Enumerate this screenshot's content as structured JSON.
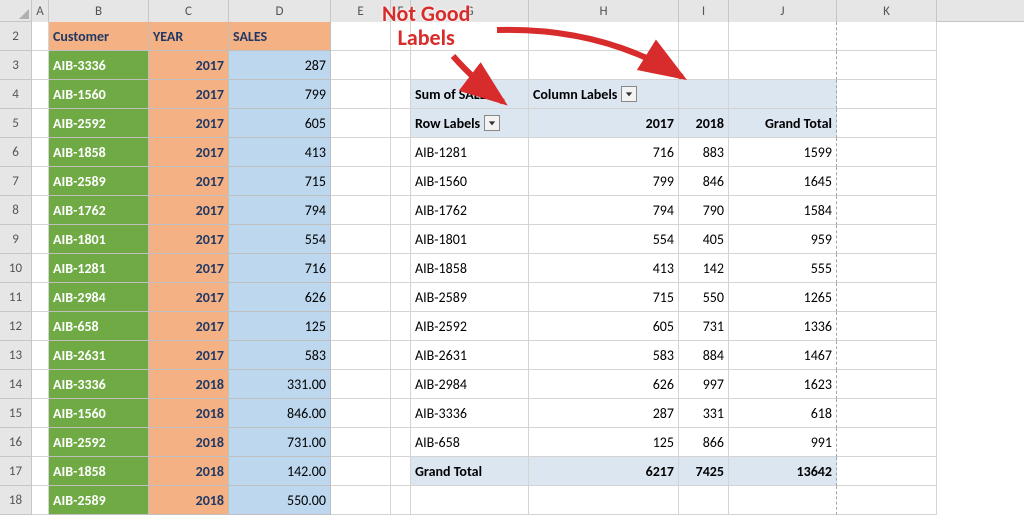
{
  "columns": [
    "A",
    "B",
    "C",
    "D",
    "E",
    "F",
    "G",
    "H",
    "I",
    "J",
    "K"
  ],
  "rowNumbers": [
    2,
    3,
    4,
    5,
    6,
    7,
    8,
    9,
    10,
    11,
    12,
    13,
    14,
    15,
    16,
    17,
    18
  ],
  "source": {
    "headers": {
      "customer": "Customer",
      "year": "YEAR",
      "sales": "SALES"
    },
    "rows": [
      {
        "customer": "AIB-3336",
        "year": "2017",
        "sales": "287"
      },
      {
        "customer": "AIB-1560",
        "year": "2017",
        "sales": "799"
      },
      {
        "customer": "AIB-2592",
        "year": "2017",
        "sales": "605"
      },
      {
        "customer": "AIB-1858",
        "year": "2017",
        "sales": "413"
      },
      {
        "customer": "AIB-2589",
        "year": "2017",
        "sales": "715"
      },
      {
        "customer": "AIB-1762",
        "year": "2017",
        "sales": "794"
      },
      {
        "customer": "AIB-1801",
        "year": "2017",
        "sales": "554"
      },
      {
        "customer": "AIB-1281",
        "year": "2017",
        "sales": "716"
      },
      {
        "customer": "AIB-2984",
        "year": "2017",
        "sales": "626"
      },
      {
        "customer": "AIB-658",
        "year": "2017",
        "sales": "125"
      },
      {
        "customer": "AIB-2631",
        "year": "2017",
        "sales": "583"
      },
      {
        "customer": "AIB-3336",
        "year": "2018",
        "sales": "331.00"
      },
      {
        "customer": "AIB-1560",
        "year": "2018",
        "sales": "846.00"
      },
      {
        "customer": "AIB-2592",
        "year": "2018",
        "sales": "731.00"
      },
      {
        "customer": "AIB-1858",
        "year": "2018",
        "sales": "142.00"
      },
      {
        "customer": "AIB-2589",
        "year": "2018",
        "sales": "550.00"
      }
    ]
  },
  "pivot": {
    "valueLabel": "Sum of SALES",
    "columnLabels": "Column Labels",
    "rowLabels": "Row Labels",
    "grandTotalLabel": "Grand Total",
    "colHeaders": [
      "2017",
      "2018",
      "Grand Total"
    ],
    "rows": [
      {
        "label": "AIB-1281",
        "y2017": "716",
        "y2018": "883",
        "total": "1599"
      },
      {
        "label": "AIB-1560",
        "y2017": "799",
        "y2018": "846",
        "total": "1645"
      },
      {
        "label": "AIB-1762",
        "y2017": "794",
        "y2018": "790",
        "total": "1584"
      },
      {
        "label": "AIB-1801",
        "y2017": "554",
        "y2018": "405",
        "total": "959"
      },
      {
        "label": "AIB-1858",
        "y2017": "413",
        "y2018": "142",
        "total": "555"
      },
      {
        "label": "AIB-2589",
        "y2017": "715",
        "y2018": "550",
        "total": "1265"
      },
      {
        "label": "AIB-2592",
        "y2017": "605",
        "y2018": "731",
        "total": "1336"
      },
      {
        "label": "AIB-2631",
        "y2017": "583",
        "y2018": "884",
        "total": "1467"
      },
      {
        "label": "AIB-2984",
        "y2017": "626",
        "y2018": "997",
        "total": "1623"
      },
      {
        "label": "AIB-3336",
        "y2017": "287",
        "y2018": "331",
        "total": "618"
      },
      {
        "label": "AIB-658",
        "y2017": "125",
        "y2018": "866",
        "total": "991"
      }
    ],
    "grandTotal": {
      "y2017": "6217",
      "y2018": "7425",
      "total": "13642"
    }
  },
  "annotation": {
    "line1": "Not Good",
    "line2": "Labels"
  }
}
